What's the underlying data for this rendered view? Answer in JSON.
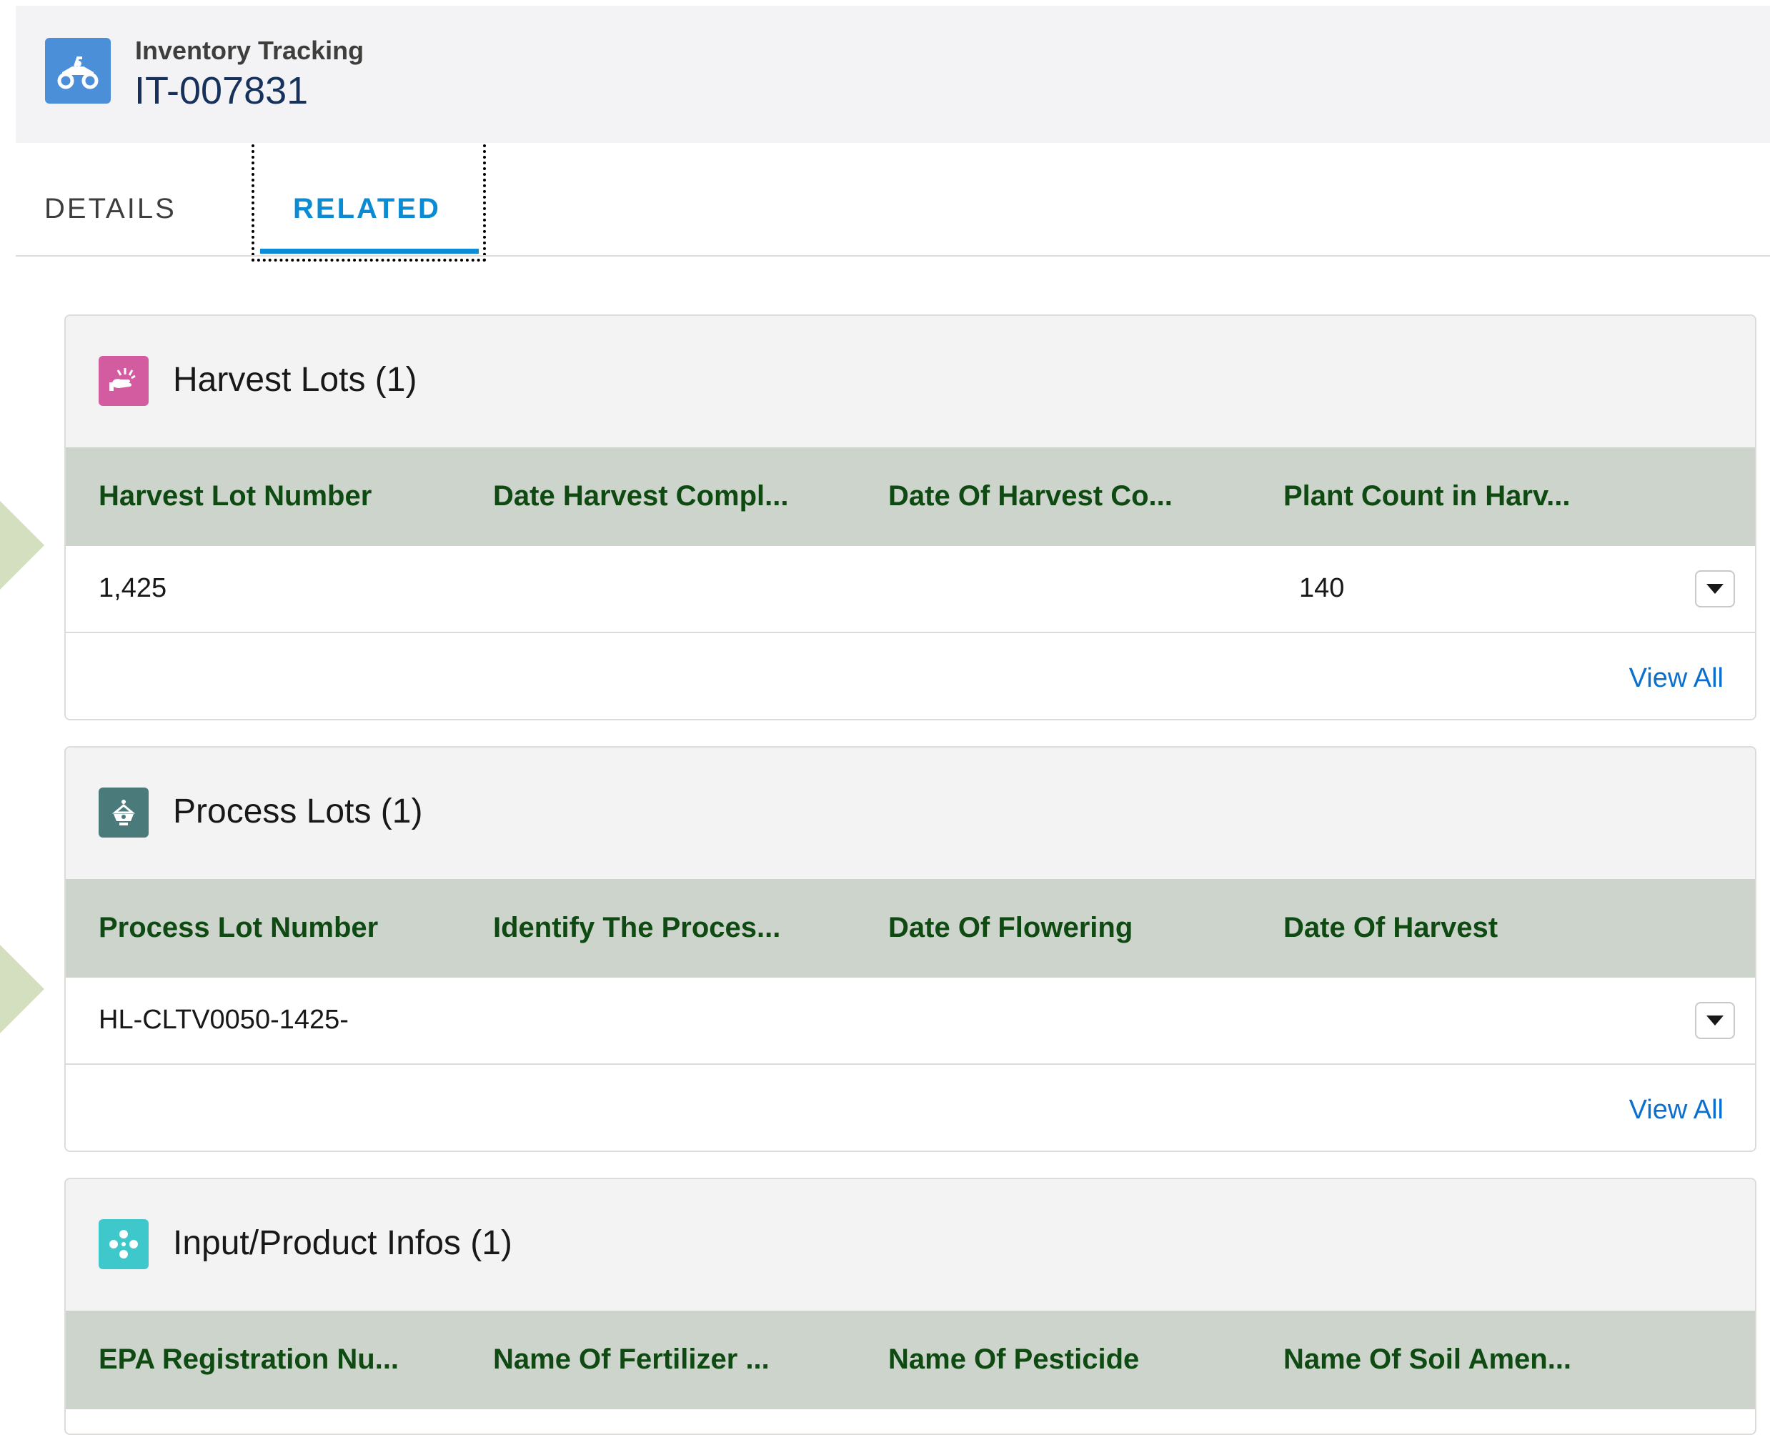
{
  "header": {
    "object_type": "Inventory Tracking",
    "record_name": "IT-007831",
    "icon": "atv-icon"
  },
  "tabs": [
    {
      "label": "DETAILS",
      "active": false
    },
    {
      "label": "RELATED",
      "active": true
    }
  ],
  "cards": {
    "harvest_lots": {
      "title": "Harvest Lots (1)",
      "icon": "hand-sparkle-icon",
      "icon_color": "#d35ba0",
      "columns": [
        "Harvest Lot Number",
        "Date Harvest Compl...",
        "Date Of Harvest Co...",
        "Plant Count in Harv..."
      ],
      "rows": [
        {
          "c0": "1,425",
          "c1": "",
          "c2": "",
          "c3": "140"
        }
      ],
      "footer_link": "View All"
    },
    "process_lots": {
      "title": "Process Lots (1)",
      "icon": "process-icon",
      "icon_color": "#4b7a7a",
      "columns": [
        "Process Lot Number",
        "Identify The Proces...",
        "Date Of Flowering",
        "Date Of Harvest"
      ],
      "rows": [
        {
          "c0": "HL-CLTV0050-1425-",
          "c1": "",
          "c2": "",
          "c3": ""
        }
      ],
      "footer_link": "View All"
    },
    "input_product_infos": {
      "title": "Input/Product Infos (1)",
      "icon": "molecule-icon",
      "icon_color": "#3fc8cc",
      "columns": [
        "EPA Registration Nu...",
        "Name Of Fertilizer ...",
        "Name Of Pesticide",
        "Name Of Soil Amen..."
      ]
    }
  },
  "colors": {
    "tab_active": "#0b8bd3",
    "column_header_bg": "#ccd4cc",
    "column_header_text": "#0e4a12",
    "link": "#0b6fd0",
    "side_arrow": "#d4dfbf"
  }
}
